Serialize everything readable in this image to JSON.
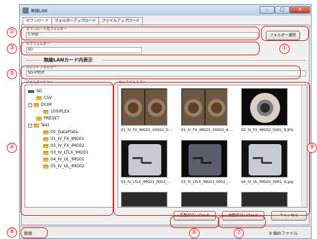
{
  "window": {
    "title": "無線LAN"
  },
  "tabs": [
    {
      "label": "ダウンロード"
    },
    {
      "label": "フォルダーアップロード"
    },
    {
      "label": "ファイルアップロード"
    }
  ],
  "download_folder": {
    "label": "ダウンロード先フォルダー",
    "value": "C:¥SD"
  },
  "folder_select_button": "フォルダー選択",
  "sub_folder": {
    "label": "サブフォルダー",
    "value": "SD"
  },
  "section_title": "無線LANカード内表示",
  "current_folder": {
    "label": "カレントフォルダー",
    "value": "SD:¥TEST"
  },
  "folder_tree": {
    "label": "フォルダーツリー",
    "items": [
      {
        "label": "SD",
        "type": "drive"
      },
      {
        "label": "CSV"
      },
      {
        "label": "DCIM",
        "expand": "−"
      },
      {
        "label": "100IPLEX"
      },
      {
        "label": "PRESET"
      },
      {
        "label": "Test",
        "expand": "−"
      },
      {
        "label": "00_DataPlate"
      },
      {
        "label": "01_IV_FX_IMG01"
      },
      {
        "label": "02_IV_FX_IMG02"
      },
      {
        "label": "03_IV_LTLX_IMG01"
      },
      {
        "label": "04_IV_UL_IMG01"
      },
      {
        "label": "05_IV_UL_IMG02"
      }
    ]
  },
  "thumbnail_list": {
    "label": "サムネイルリスト",
    "items": [
      {
        "caption": "01_IV_FX_IMG01_00001_D....",
        "kind": "dual"
      },
      {
        "caption": "01_IV_FX_IMG01_00002_A....",
        "kind": "dual"
      },
      {
        "caption": "02_IV_FX_IMG02_0001_B.JPG",
        "kind": "single"
      },
      {
        "caption": "03_IV_LTLX_IMG01_0001_...",
        "kind": "light"
      },
      {
        "caption": "03_IV_LTLX_IMG01_0002_...",
        "kind": "dark"
      },
      {
        "caption": "04_IV_UL_IMG01_0001_A.jpg",
        "kind": "light"
      }
    ]
  },
  "buttons": {
    "manual_download": "手動ダウンロード",
    "auto_download": "自動ダウンロード",
    "cancel": "キャンセル"
  },
  "status": {
    "text": "接続",
    "file_count": "9 個のファイル"
  },
  "callouts": [
    "①",
    "②",
    "③",
    "④",
    "⑤",
    "⑥",
    "⑦",
    "⑧",
    "⑨"
  ],
  "colors": {
    "callout": "#d92727",
    "folder": "#e2b54a"
  }
}
